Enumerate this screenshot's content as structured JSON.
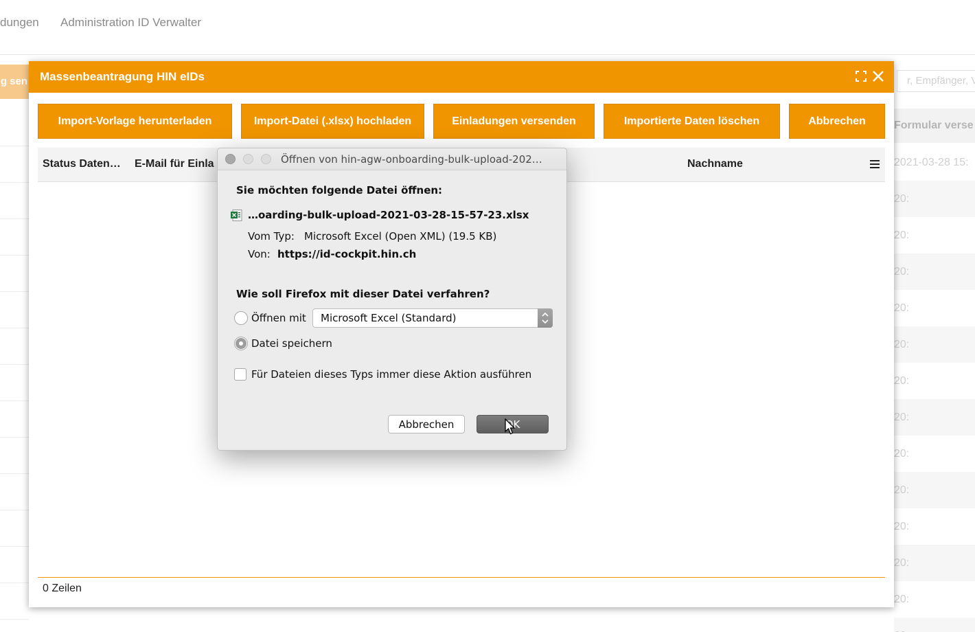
{
  "background": {
    "nav_items": [
      "dungen",
      "Administration ID Verwalter"
    ],
    "left_button_fragment": "g sen",
    "search_placeholder_fragment": "r, Empfänger, V",
    "right_header_fragment": "Formular verse",
    "right_rows": [
      "2021-03-28 15:",
      "20:",
      "20:",
      "20:",
      "20:",
      "20:",
      "20:",
      "20:",
      "20:",
      "20:",
      "20:",
      "20:",
      "20:",
      "20:"
    ]
  },
  "modal": {
    "title": "Massenbeantragung HIN eIDs",
    "toolbar": {
      "download_template": "Import-Vorlage herunterladen",
      "upload_file": "Import-Datei (.xlsx) hochladen",
      "send_invitations": "Einladungen versenden",
      "delete_imported": "Importierte Daten löschen",
      "cancel": "Abbrechen"
    },
    "columns": {
      "status": "Status Daten…",
      "email": "E-Mail für Einla",
      "lastname": "Nachname"
    },
    "row_count": "0 Zeilen"
  },
  "dialog": {
    "title": "Öffnen von hin-agw-onboarding-bulk-upload-202…",
    "prompt": "Sie möchten folgende Datei öffnen:",
    "filename": "…oarding-bulk-upload-2021-03-28-15-57-23.xlsx",
    "type_label": "Vom Typ:",
    "type_value": "Microsoft Excel (Open XML) (19.5 KB)",
    "from_label": "Von:",
    "from_value": "https://id-cockpit.hin.ch",
    "question": "Wie soll Firefox mit dieser Datei verfahren?",
    "open_with_label": "Öffnen mit",
    "open_with_value": "Microsoft Excel (Standard)",
    "save_file_label": "Datei speichern",
    "always_label": "Für Dateien dieses Typs immer diese Aktion ausführen",
    "cancel_label": "Abbrechen",
    "ok_label": "OK",
    "selected_option": "save_file"
  },
  "colors": {
    "accent": "#f09500",
    "ok_button": "#6e6e6e"
  },
  "icons": [
    "expand-icon",
    "close-icon",
    "column-menu-icon",
    "xlsx-file-icon",
    "stepper-arrows-icon",
    "mouse-cursor-icon"
  ]
}
